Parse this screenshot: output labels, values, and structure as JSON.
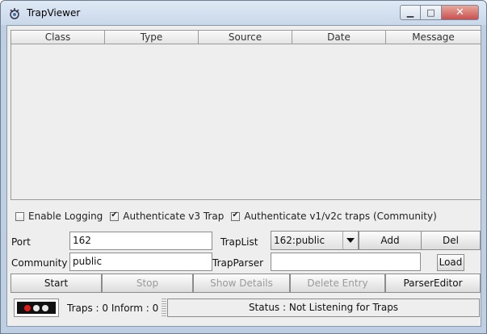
{
  "window": {
    "title": "TrapViewer",
    "controls": {
      "minimize": "▭",
      "maximize": "□",
      "close": "✕"
    }
  },
  "table": {
    "columns": [
      "Class",
      "Type",
      "Source",
      "Date",
      "Message"
    ],
    "rows": []
  },
  "options": {
    "enable_logging": {
      "label": "Enable Logging",
      "checked": false
    },
    "auth_v3": {
      "label": "Authenticate v3 Trap",
      "checked": true
    },
    "auth_v1v2c": {
      "label": "Authenticate v1/v2c traps (Community)",
      "checked": true
    }
  },
  "form": {
    "port_label": "Port",
    "port_value": "162",
    "community_label": "Community",
    "community_value": "public",
    "traplist_label": "TrapList",
    "traplist_selected": "162:public",
    "trapparser_label": "TrapParser",
    "trapparser_value": "",
    "add_label": "Add",
    "del_label": "Del",
    "load_label": "Load"
  },
  "actions": {
    "start": "Start",
    "stop": "Stop",
    "show_details": "Show Details",
    "delete_entry": "Delete Entry",
    "parser_editor": "ParserEditor"
  },
  "statusbar": {
    "counts": "Traps :  0 Inform :  0",
    "status": "Status : Not Listening for Traps",
    "led_colors": [
      "#e21b1b",
      "#e8e8e8",
      "#e8e8e8"
    ]
  }
}
